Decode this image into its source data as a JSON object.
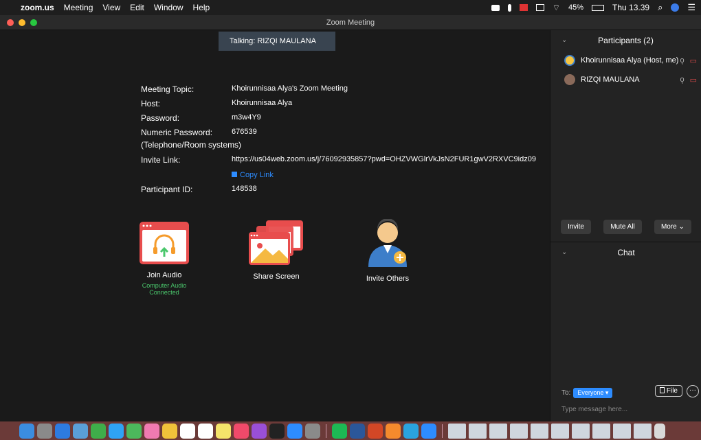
{
  "menubar": {
    "app_name": "zoom.us",
    "menus": [
      "Meeting",
      "View",
      "Edit",
      "Window",
      "Help"
    ],
    "battery": "45%",
    "clock": "Thu 13.39"
  },
  "window": {
    "title": "Zoom Meeting"
  },
  "talking": "Talking: RIZQI MAULANA",
  "meeting": {
    "topic_label": "Meeting Topic:",
    "topic": "Khoirunnisaa Alya's Zoom Meeting",
    "host_label": "Host:",
    "host": "Khoirunnisaa Alya",
    "password_label": "Password:",
    "password": "m3w4Y9",
    "numeric_label": "Numeric Password:",
    "numeric_sub": "(Telephone/Room systems)",
    "numeric": "676539",
    "invite_label": "Invite Link:",
    "invite_link": "https://us04web.zoom.us/j/76092935857?pwd=OHZVWGlrVkJsN2FUR1gwV2RXVC9idz09",
    "copy_link": "Copy Link",
    "participant_id_label": "Participant ID:",
    "participant_id": "148538"
  },
  "actions": {
    "join_audio": "Join Audio",
    "join_audio_sub": "Computer Audio Connected",
    "share_screen": "Share Screen",
    "invite_others": "Invite Others"
  },
  "participants": {
    "title": "Participants (2)",
    "list": [
      {
        "name": "Khoirunnisaa Alya (Host, me)"
      },
      {
        "name": "RIZQI MAULANA"
      }
    ],
    "invite": "Invite",
    "mute_all": "Mute All",
    "more": "More ⌄"
  },
  "chat": {
    "title": "Chat",
    "to_label": "To:",
    "recipient": "Everyone ▾",
    "file": "File",
    "more": "···",
    "placeholder": "Type message here..."
  },
  "colors": {
    "accent": "#2d8cff",
    "danger": "#e84d4d",
    "connected": "#4ac76c",
    "panel": "#232323",
    "dock": "#6b3a38"
  },
  "dock_icons": [
    "finder-icon",
    "launchpad-icon",
    "safari-icon",
    "preview-icon",
    "facetime-icon",
    "messages-icon",
    "maps-icon",
    "photos-icon",
    "notes-icon",
    "calendar-icon",
    "reminders-icon",
    "stickies-icon",
    "music-icon",
    "podcasts-icon",
    "tv-icon",
    "appstore-icon",
    "preferences-icon",
    "spotify-icon",
    "word-icon",
    "powerpoint-icon",
    "pages-icon",
    "telegram-icon",
    "zoom-icon",
    "window-thumb-1",
    "window-thumb-2",
    "window-thumb-3",
    "window-thumb-4",
    "window-thumb-5",
    "window-thumb-6",
    "window-thumb-7",
    "window-thumb-8",
    "window-thumb-9",
    "window-thumb-10",
    "trash-icon"
  ]
}
